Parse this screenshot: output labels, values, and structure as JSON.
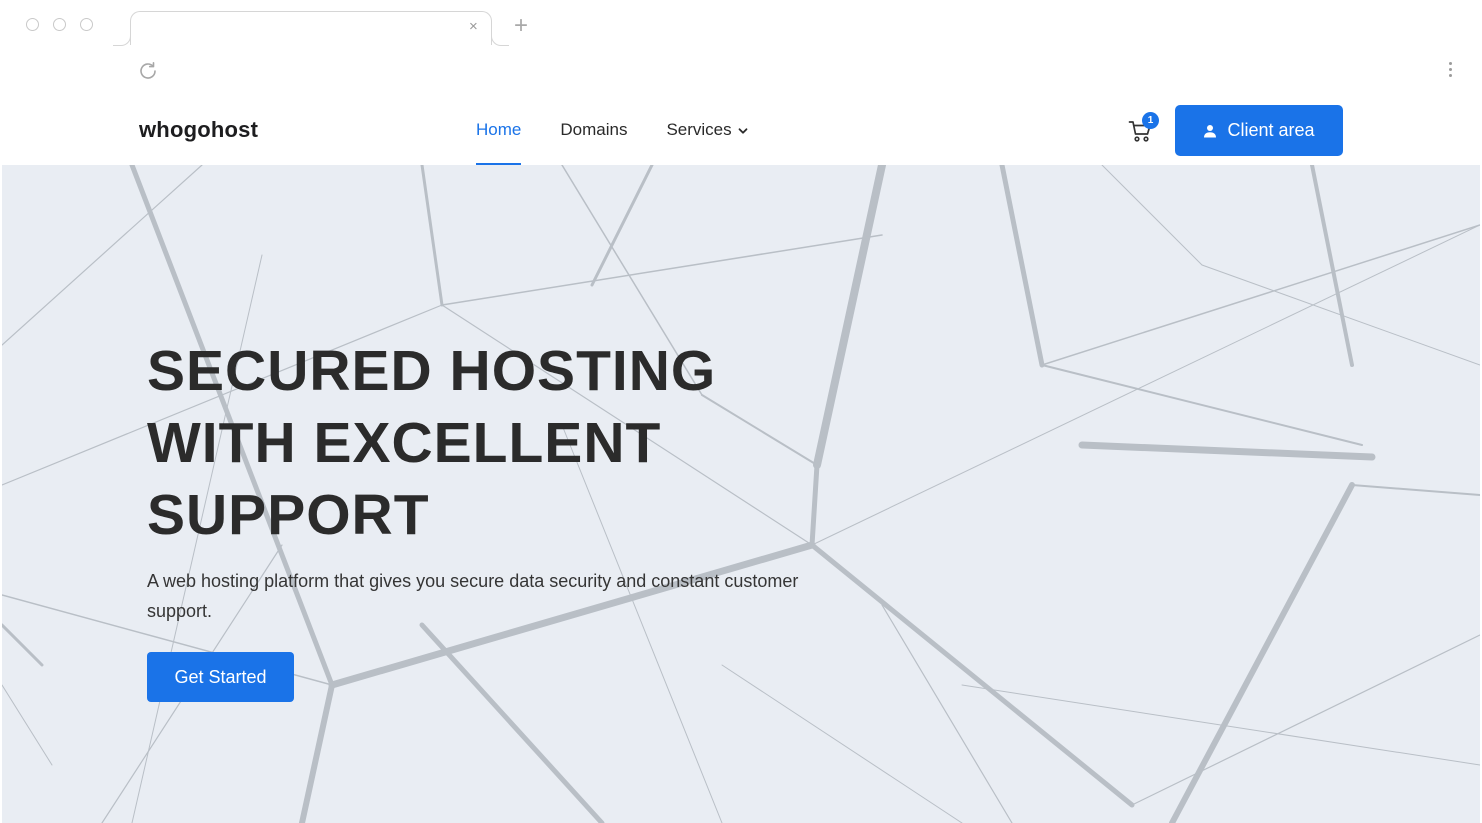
{
  "browser": {
    "tab_close_glyph": "×",
    "new_tab_glyph": "+",
    "icons": [
      "reload-icon",
      "kebab-menu-icon"
    ]
  },
  "nav": {
    "brand": "whogohost",
    "items": [
      {
        "label": "Home",
        "active": true
      },
      {
        "label": "Domains",
        "active": false
      },
      {
        "label": "Services",
        "active": false,
        "has_dropdown": true
      }
    ],
    "cart_count": "1",
    "client_area_label": "Client area"
  },
  "hero": {
    "title_lines": [
      "SECURED HOSTING",
      "WITH EXCELLENT",
      "SUPPORT"
    ],
    "subtitle": "A web hosting platform that gives you secure data security and constant customer support.",
    "cta_label": "Get Started"
  },
  "colors": {
    "accent": "#1a73e8",
    "hero_bg": "#e9edf3",
    "heading": "#2b2b2b"
  }
}
